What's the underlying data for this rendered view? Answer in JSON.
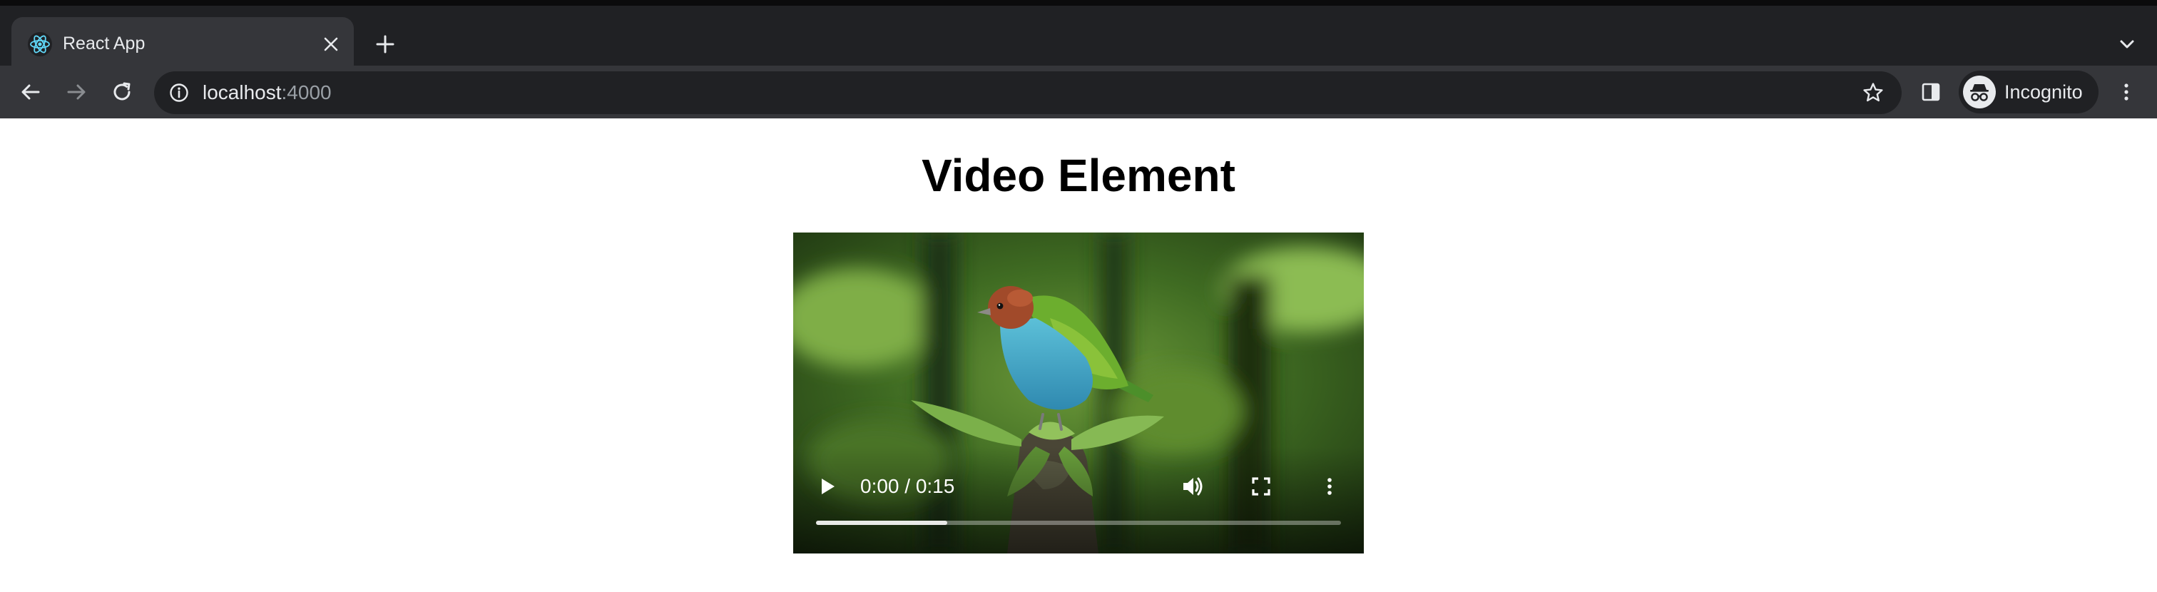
{
  "browser": {
    "tab": {
      "title": "React App",
      "favicon": "react-logo-icon"
    },
    "address_bar": {
      "host": "localhost",
      "port": ":4000"
    },
    "profile": {
      "label": "Incognito",
      "icon": "incognito-icon"
    },
    "icons": {
      "close_tab": "close-icon",
      "new_tab": "plus-icon",
      "tab_search": "chevron-down-icon",
      "back": "arrow-left-icon",
      "forward": "arrow-right-icon",
      "reload": "reload-icon",
      "site_info": "info-icon",
      "bookmark": "star-icon",
      "side_panel": "side-panel-icon",
      "menu": "kebab-menu-icon"
    },
    "colors": {
      "tabstrip": "#202124",
      "toolbar": "#35363a",
      "omnibox": "#202124",
      "text": "#e8eaed",
      "muted_text": "#9aa0a6"
    }
  },
  "page": {
    "heading": "Video Element"
  },
  "video": {
    "time_display": "0:00 / 0:15",
    "buffered_fraction": 0.25,
    "controls": {
      "play": "play-icon",
      "volume": "volume-icon",
      "fullscreen": "fullscreen-icon",
      "more": "kebab-menu-icon"
    }
  }
}
